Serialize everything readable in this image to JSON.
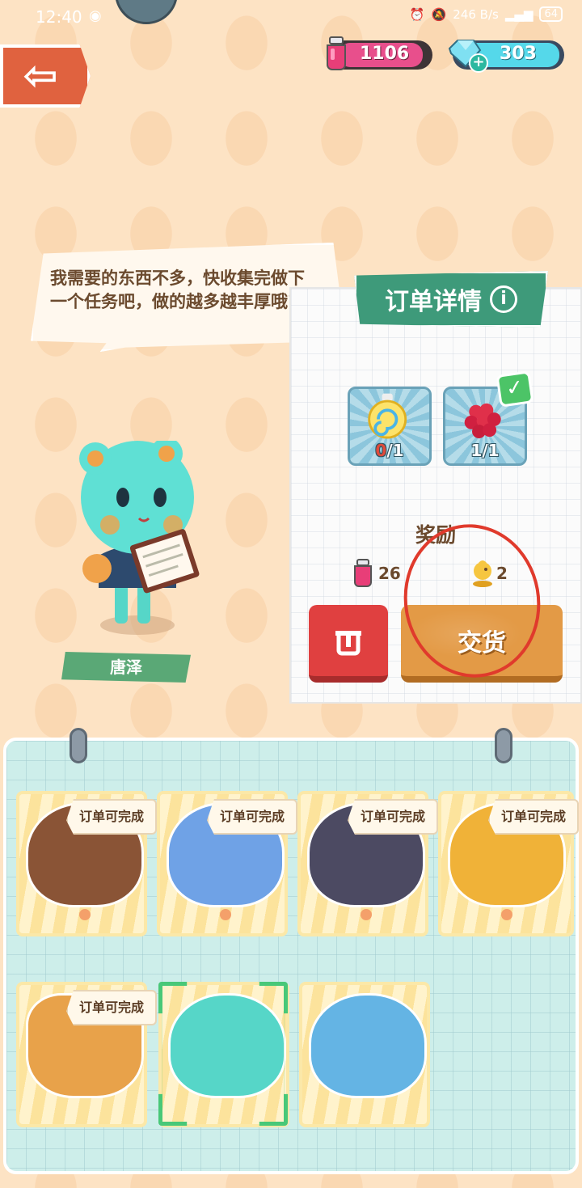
{
  "status_bar": {
    "time": "12:40",
    "network_speed": "246 B/s",
    "battery": "64"
  },
  "currency": {
    "ink": "1106",
    "gems": "303"
  },
  "npc": {
    "dialogue": "我需要的东西不多，快收集完做下一个任务吧，做的越多越丰厚哦˜",
    "name": "唐泽"
  },
  "order": {
    "title": "订单详情",
    "requirements": [
      {
        "item": "swirl-candy",
        "have": "0",
        "need": "/1",
        "complete": false
      },
      {
        "item": "raspberry",
        "have": "1",
        "need": "/1",
        "complete": true
      }
    ],
    "reward_label": "奖励",
    "rewards": [
      {
        "item": "ink-jar",
        "amount": "26"
      },
      {
        "item": "chick-figure",
        "amount": "2"
      }
    ],
    "deliver_label": "交货"
  },
  "board": {
    "cards": [
      {
        "name": "bear-chef",
        "badge": "订单可完成",
        "color": "#8a5436"
      },
      {
        "name": "blue-cat",
        "badge": "订单可完成",
        "color": "#6fa2e6"
      },
      {
        "name": "dark-horse",
        "badge": "订单可完成",
        "color": "#4c4a62"
      },
      {
        "name": "shiba-dog",
        "badge": "订单可完成",
        "color": "#f0b238"
      },
      {
        "name": "bread-roll",
        "badge": "订单可完成",
        "color": "#e8a24a"
      },
      {
        "name": "teal-bear",
        "badge": "",
        "color": "#56d6c8"
      },
      {
        "name": "blue-wolf",
        "badge": "",
        "color": "#64b4e4"
      }
    ]
  },
  "colors": {
    "accent_green": "#3e9a7a",
    "deliver_orange": "#e39a46",
    "discard_red": "#e04040",
    "annotation_red": "#e03a2c"
  }
}
